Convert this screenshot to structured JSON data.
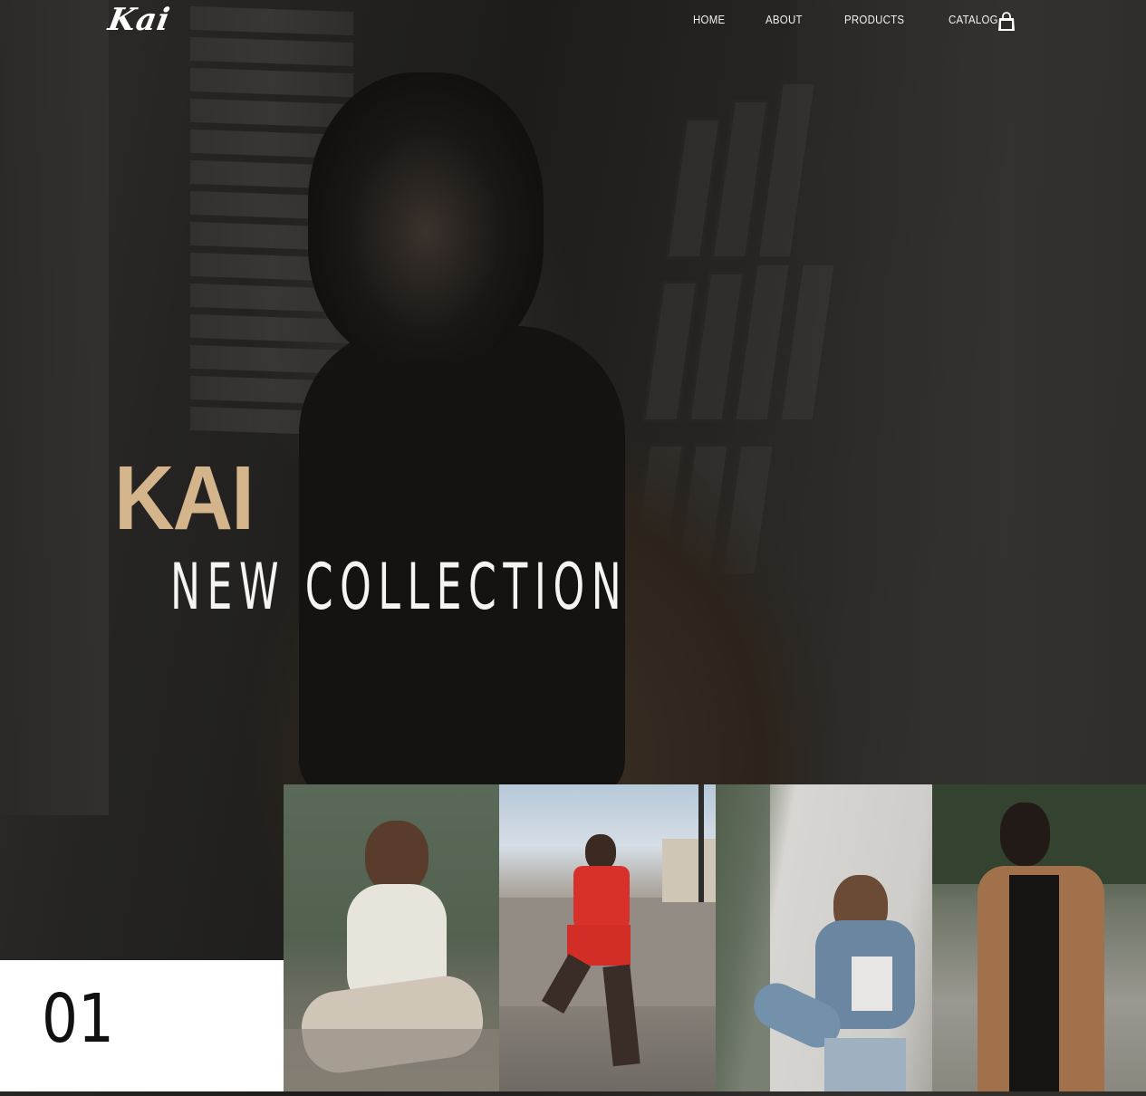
{
  "header": {
    "logo": "Kai",
    "nav": [
      "HOME",
      "ABOUT",
      "PRODUCTS",
      "CATALOG"
    ],
    "cart_icon": "shopping-bag-icon"
  },
  "hero": {
    "brand": "KAI",
    "subtitle": "NEW COLLECTION"
  },
  "slider": {
    "index": "01"
  },
  "colors": {
    "accent": "#d4b48b",
    "nav_text": "#f2f2f2",
    "number_box": "#ffffff"
  }
}
